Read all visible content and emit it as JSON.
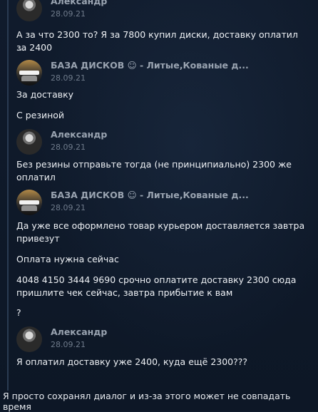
{
  "messages": [
    {
      "author": "Александр",
      "date": "28.09.21",
      "avatar": "person-avatar",
      "lines": [
        "А за что 2300 то? Я за 7800 купил диски, доставку оплатил за 2400",
        "..."
      ]
    },
    {
      "author": "БАЗА ДИСКОВ",
      "author_suffix": "- Литые,Кованые д...",
      "date": "28.09.21",
      "avatar": "baza-diskov-logo",
      "lines": [
        "За доставку",
        "С резиной"
      ]
    },
    {
      "author": "Александр",
      "date": "28.09.21",
      "avatar": "person-avatar",
      "lines": [
        "Без резины отправьте тогда (не принципиально) 2300 же",
        "оплатил"
      ]
    },
    {
      "author": "БАЗА ДИСКОВ",
      "author_suffix": "- Литые,Кованые д...",
      "date": "28.09.21",
      "avatar": "baza-diskov-logo",
      "lines": [
        "Да уже все оформлено товар курьером доставляется завтра",
        "привезут",
        "Оплата нужна сейчас",
        "4048 4150 3444 9690 срочно оплатите доставку 2300 сюда",
        "пришлите чек сейчас, завтра прибытие к вам",
        "?"
      ]
    },
    {
      "author": "Александр",
      "date": "28.09.21",
      "avatar": "person-avatar",
      "lines": [
        "Я оплатил доставку уже 2400, куда ещё 2300???"
      ]
    }
  ],
  "footer_note": "Я просто сохранял диалог и из-за этого может не совпадать время",
  "colors": {
    "background": "#0f1a2b",
    "thread_line": "#2a3b52",
    "author": "#9aa4b1",
    "date": "#6f7b8b",
    "text": "#eef1f5"
  }
}
